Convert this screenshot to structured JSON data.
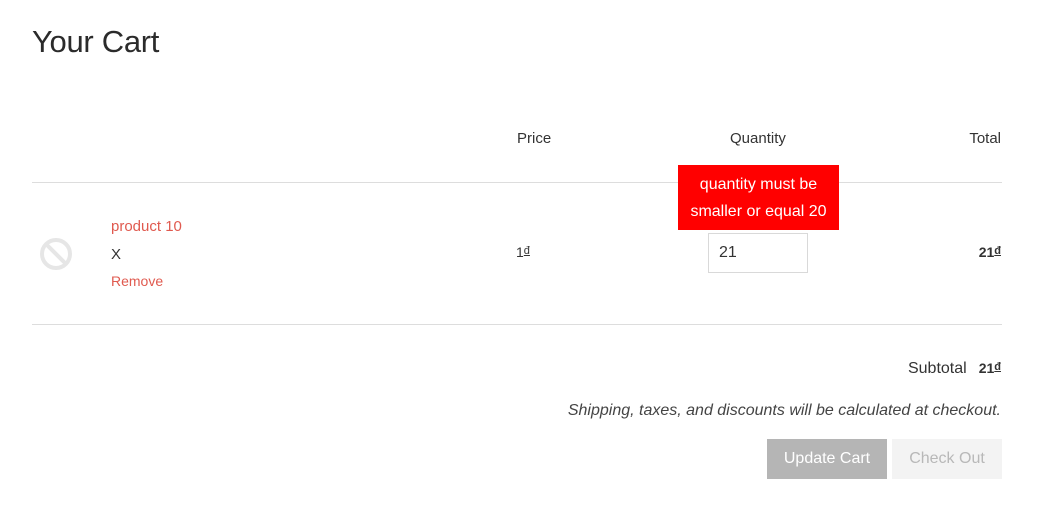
{
  "page": {
    "title": "Your Cart"
  },
  "table": {
    "headers": {
      "price": "Price",
      "quantity": "Quantity",
      "total": "Total"
    },
    "rows": [
      {
        "image_icon": "no-image-icon",
        "name": "product 10",
        "variant": "X",
        "remove_label": "Remove",
        "price": "1",
        "quantity": "21",
        "total": "21"
      }
    ]
  },
  "currency_symbol": "đ",
  "validation": {
    "quantity_error_line1": "quantity must be",
    "quantity_error_line2": "smaller or equal 20"
  },
  "summary": {
    "subtotal_label": "Subtotal",
    "subtotal_value": "21",
    "shipping_note": "Shipping, taxes, and discounts will be calculated at checkout."
  },
  "actions": {
    "update_cart": "Update Cart",
    "check_out": "Check Out"
  },
  "colors": {
    "accent": "#e05a4f",
    "error": "#ff0000",
    "button_primary": "#b5b5b5",
    "button_disabled": "#f3f3f3"
  }
}
